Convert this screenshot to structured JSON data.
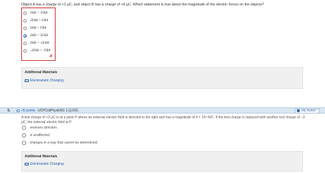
{
  "question1": {
    "text": "Object A has a charge of +2 µC, and object B has a charge of +6 µC. Which statement is true about the magnitude of the electric forces on the objects?",
    "options": [
      {
        "label": "FAB = -FBA",
        "selected": false
      },
      {
        "label": "3FAB = FBA",
        "selected": false
      },
      {
        "label": "FAB = FBA",
        "selected": false
      },
      {
        "label": "FAB = 3FBA",
        "selected": true
      },
      {
        "label": "FAB = -3FBA",
        "selected": false
      },
      {
        "label": "-3FAB = -FBA",
        "selected": false
      }
    ],
    "wrong_mark": "✗"
  },
  "additional_materials_1": {
    "header": "Additional Materials",
    "link": "Electrostatic Charging"
  },
  "question2_bar": {
    "number": "5.",
    "points": "-/6 points",
    "id": "UCPColPhysEM1 1.Q.002.",
    "my_notes": "My Notes"
  },
  "question2": {
    "text": "A test charge of +3 µC is at a point P where an external electric field is directed to the right and has a magnitude of 4 × 10⁶ N/C. If the test charge is replaced with another test charge of −3 µC, the external electric field at P",
    "options": [
      {
        "label": "reverses direction."
      },
      {
        "label": "is unaffected."
      },
      {
        "label": "changes in a way that cannot be determined."
      }
    ]
  },
  "additional_materials_2": {
    "header": "Additional Materials",
    "link": "Electrostatic Charging"
  },
  "colors": {
    "accent": "#1f5fa8",
    "error": "#c9302c",
    "bar_bg": "#d8e6f3"
  }
}
